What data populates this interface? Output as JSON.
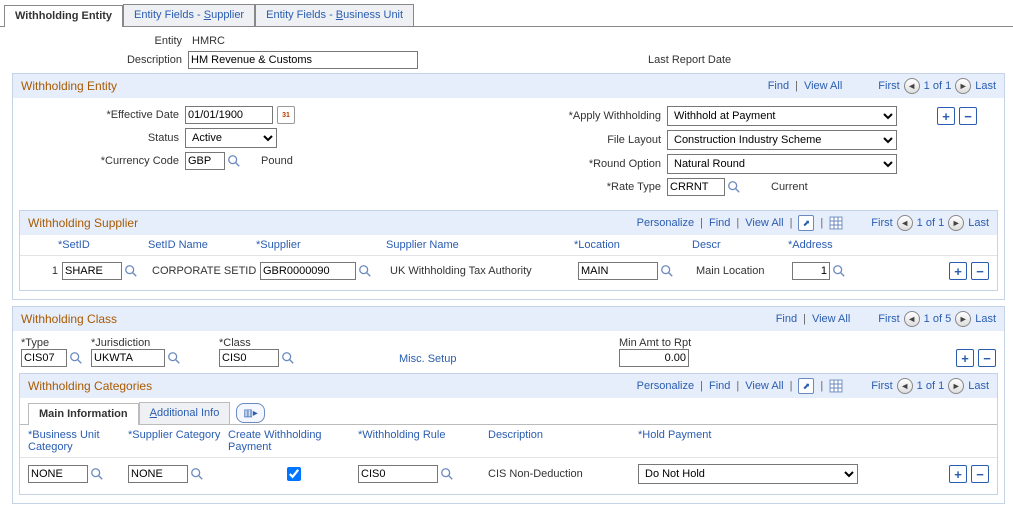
{
  "page_tabs": {
    "withholding_entity": "Withholding Entity",
    "entity_fields_supplier_pre": "Entity Fields - ",
    "entity_fields_supplier_u": "S",
    "entity_fields_supplier_post": "upplier",
    "entity_fields_bu_pre": "Entity Fields - ",
    "entity_fields_bu_u": "B",
    "entity_fields_bu_post": "usiness Unit"
  },
  "header": {
    "entity_label": "Entity",
    "entity_value": "HMRC",
    "description_label": "Description",
    "description_value": "HM Revenue & Customs",
    "last_report_label": "Last Report Date"
  },
  "entity_box": {
    "title": "Withholding Entity",
    "nav": {
      "find": "Find",
      "viewall": "View All",
      "first": "First",
      "count": "1 of 1",
      "last": "Last"
    },
    "effective_date_label": "*Effective Date",
    "effective_date_value": "01/01/1900",
    "status_label": "Status",
    "status_value": "Active",
    "currency_label": "*Currency Code",
    "currency_value": "GBP",
    "currency_name": "Pound",
    "apply_label": "*Apply Withholding",
    "apply_value": "Withhold at Payment",
    "file_layout_label": "File Layout",
    "file_layout_value": "Construction Industry Scheme",
    "round_label": "*Round Option",
    "round_value": "Natural Round",
    "rate_type_label": "*Rate Type",
    "rate_type_value": "CRRNT",
    "rate_type_name": "Current"
  },
  "supplier_box": {
    "title": "Withholding Supplier",
    "toolbar": {
      "personalize": "Personalize",
      "find": "Find",
      "viewall": "View All"
    },
    "nav": {
      "first": "First",
      "count": "1 of 1",
      "last": "Last"
    },
    "columns": {
      "rownum": "",
      "setid": "*SetID",
      "setid_name": "SetID Name",
      "supplier": "*Supplier",
      "supplier_name": "Supplier Name",
      "location": "*Location",
      "descr": "Descr",
      "address": "*Address"
    },
    "rows": [
      {
        "num": "1",
        "setid": "SHARE",
        "setid_name": "CORPORATE SETID",
        "supplier": "GBR0000090",
        "supplier_name": "UK Withholding Tax Authority",
        "location": "MAIN",
        "descr": "Main Location",
        "address": "1"
      }
    ]
  },
  "class_box": {
    "title": "Withholding Class",
    "nav": {
      "find": "Find",
      "viewall": "View All",
      "first": "First",
      "count": "1 of 5",
      "last": "Last"
    },
    "type_label": "*Type",
    "type_value": "CIS07",
    "jurisdiction_label": "*Jurisdiction",
    "jurisdiction_value": "UKWTA",
    "class_label": "*Class",
    "class_value": "CIS0",
    "misc_setup": "Misc. Setup",
    "minamt_label": "Min Amt to Rpt",
    "minamt_value": "0.00"
  },
  "categories_box": {
    "title": "Withholding Categories",
    "toolbar": {
      "personalize": "Personalize",
      "find": "Find",
      "viewall": "View All"
    },
    "nav": {
      "first": "First",
      "count": "1 of 1",
      "last": "Last"
    },
    "subtabs": {
      "main": "Main Information",
      "addl": "Additional Info"
    },
    "columns": {
      "bu_category": "*Business Unit Category",
      "supplier_category": "*Supplier Category",
      "create_pmt": "Create Withholding Payment",
      "rule": "*Withholding Rule",
      "description": "Description",
      "hold_payment": "*Hold Payment"
    },
    "rows": [
      {
        "bu_category": "NONE",
        "supplier_category": "NONE",
        "create_pmt": true,
        "rule": "CIS0",
        "description": "CIS Non-Deduction",
        "hold_payment": "Do Not Hold"
      }
    ]
  }
}
